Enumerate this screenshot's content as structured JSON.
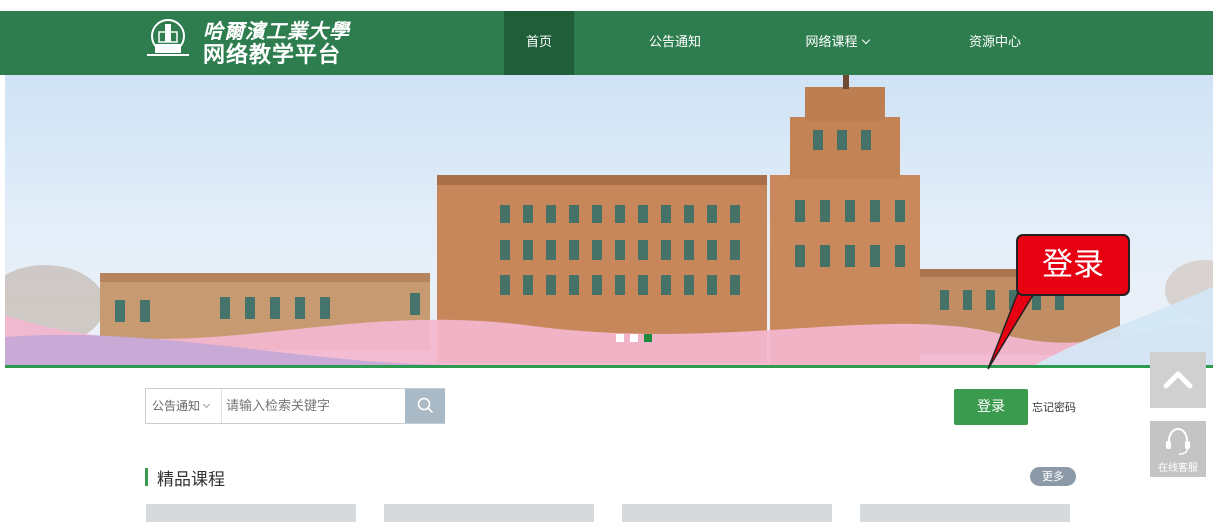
{
  "header": {
    "logo_line1": "哈爾濱工業大學",
    "logo_line2": "网络教学平台",
    "nav": [
      {
        "label": "首页",
        "active": true
      },
      {
        "label": "公告通知",
        "active": false
      },
      {
        "label": "网络课程",
        "active": false,
        "has_dropdown": true
      },
      {
        "label": "资源中心",
        "active": false
      }
    ]
  },
  "banner": {
    "slides_total": 3,
    "active_slide": 3,
    "callout_text": "登录"
  },
  "search": {
    "category": "公告通知",
    "placeholder": "请输入检索关键字"
  },
  "login": {
    "button_label": "登录",
    "forgot_label": "忘记密码"
  },
  "courses": {
    "title": "精品课程",
    "more_label": "更多"
  },
  "side_tools": {
    "service_label": "在线客服"
  },
  "colors": {
    "nav_green": "#2e7d4f",
    "nav_active": "#1f5e39",
    "accent_green": "#3a9a4e",
    "callout_red": "#e60012"
  }
}
